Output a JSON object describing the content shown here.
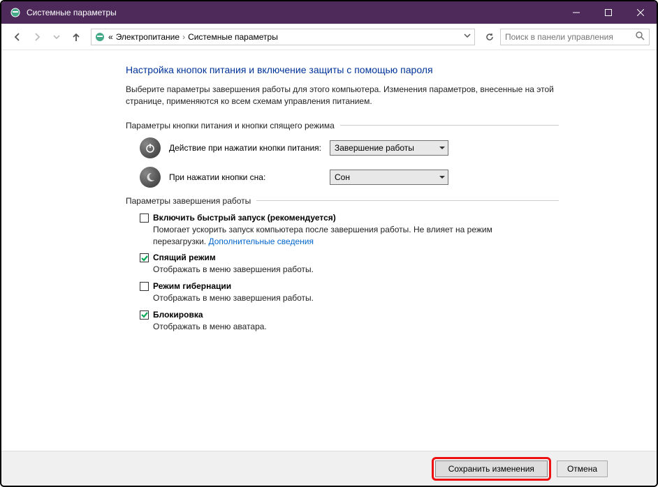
{
  "title": "Системные параметры",
  "breadcrumb": {
    "prefix": "«",
    "item1": "Электропитание",
    "item2": "Системные параметры"
  },
  "search": {
    "placeholder": "Поиск в панели управления"
  },
  "page": {
    "heading": "Настройка кнопок питания и включение защиты с помощью пароля",
    "description": "Выберите параметры завершения работы для этого компьютера. Изменения параметров, внесенные на этой странице, применяются ко всем схемам управления питанием."
  },
  "section1": {
    "title": "Параметры кнопки питания и кнопки спящего режима",
    "power": {
      "label": "Действие при нажатии кнопки питания:",
      "value": "Завершение работы"
    },
    "sleep": {
      "label": "При нажатии кнопки сна:",
      "value": "Сон"
    }
  },
  "section2": {
    "title": "Параметры завершения работы",
    "faststart": {
      "label": "Включить быстрый запуск (рекомендуется)",
      "desc": "Помогает ускорить запуск компьютера после завершения работы. Не влияет на режим перезагрузки. ",
      "link": "Дополнительные сведения",
      "checked": false
    },
    "sleep": {
      "label": "Спящий режим",
      "desc": "Отображать в меню завершения работы.",
      "checked": true
    },
    "hibernate": {
      "label": "Режим гибернации",
      "desc": "Отображать в меню завершения работы.",
      "checked": false
    },
    "lock": {
      "label": "Блокировка",
      "desc": "Отображать в меню аватара.",
      "checked": true
    }
  },
  "buttons": {
    "save": "Сохранить изменения",
    "cancel": "Отмена"
  }
}
